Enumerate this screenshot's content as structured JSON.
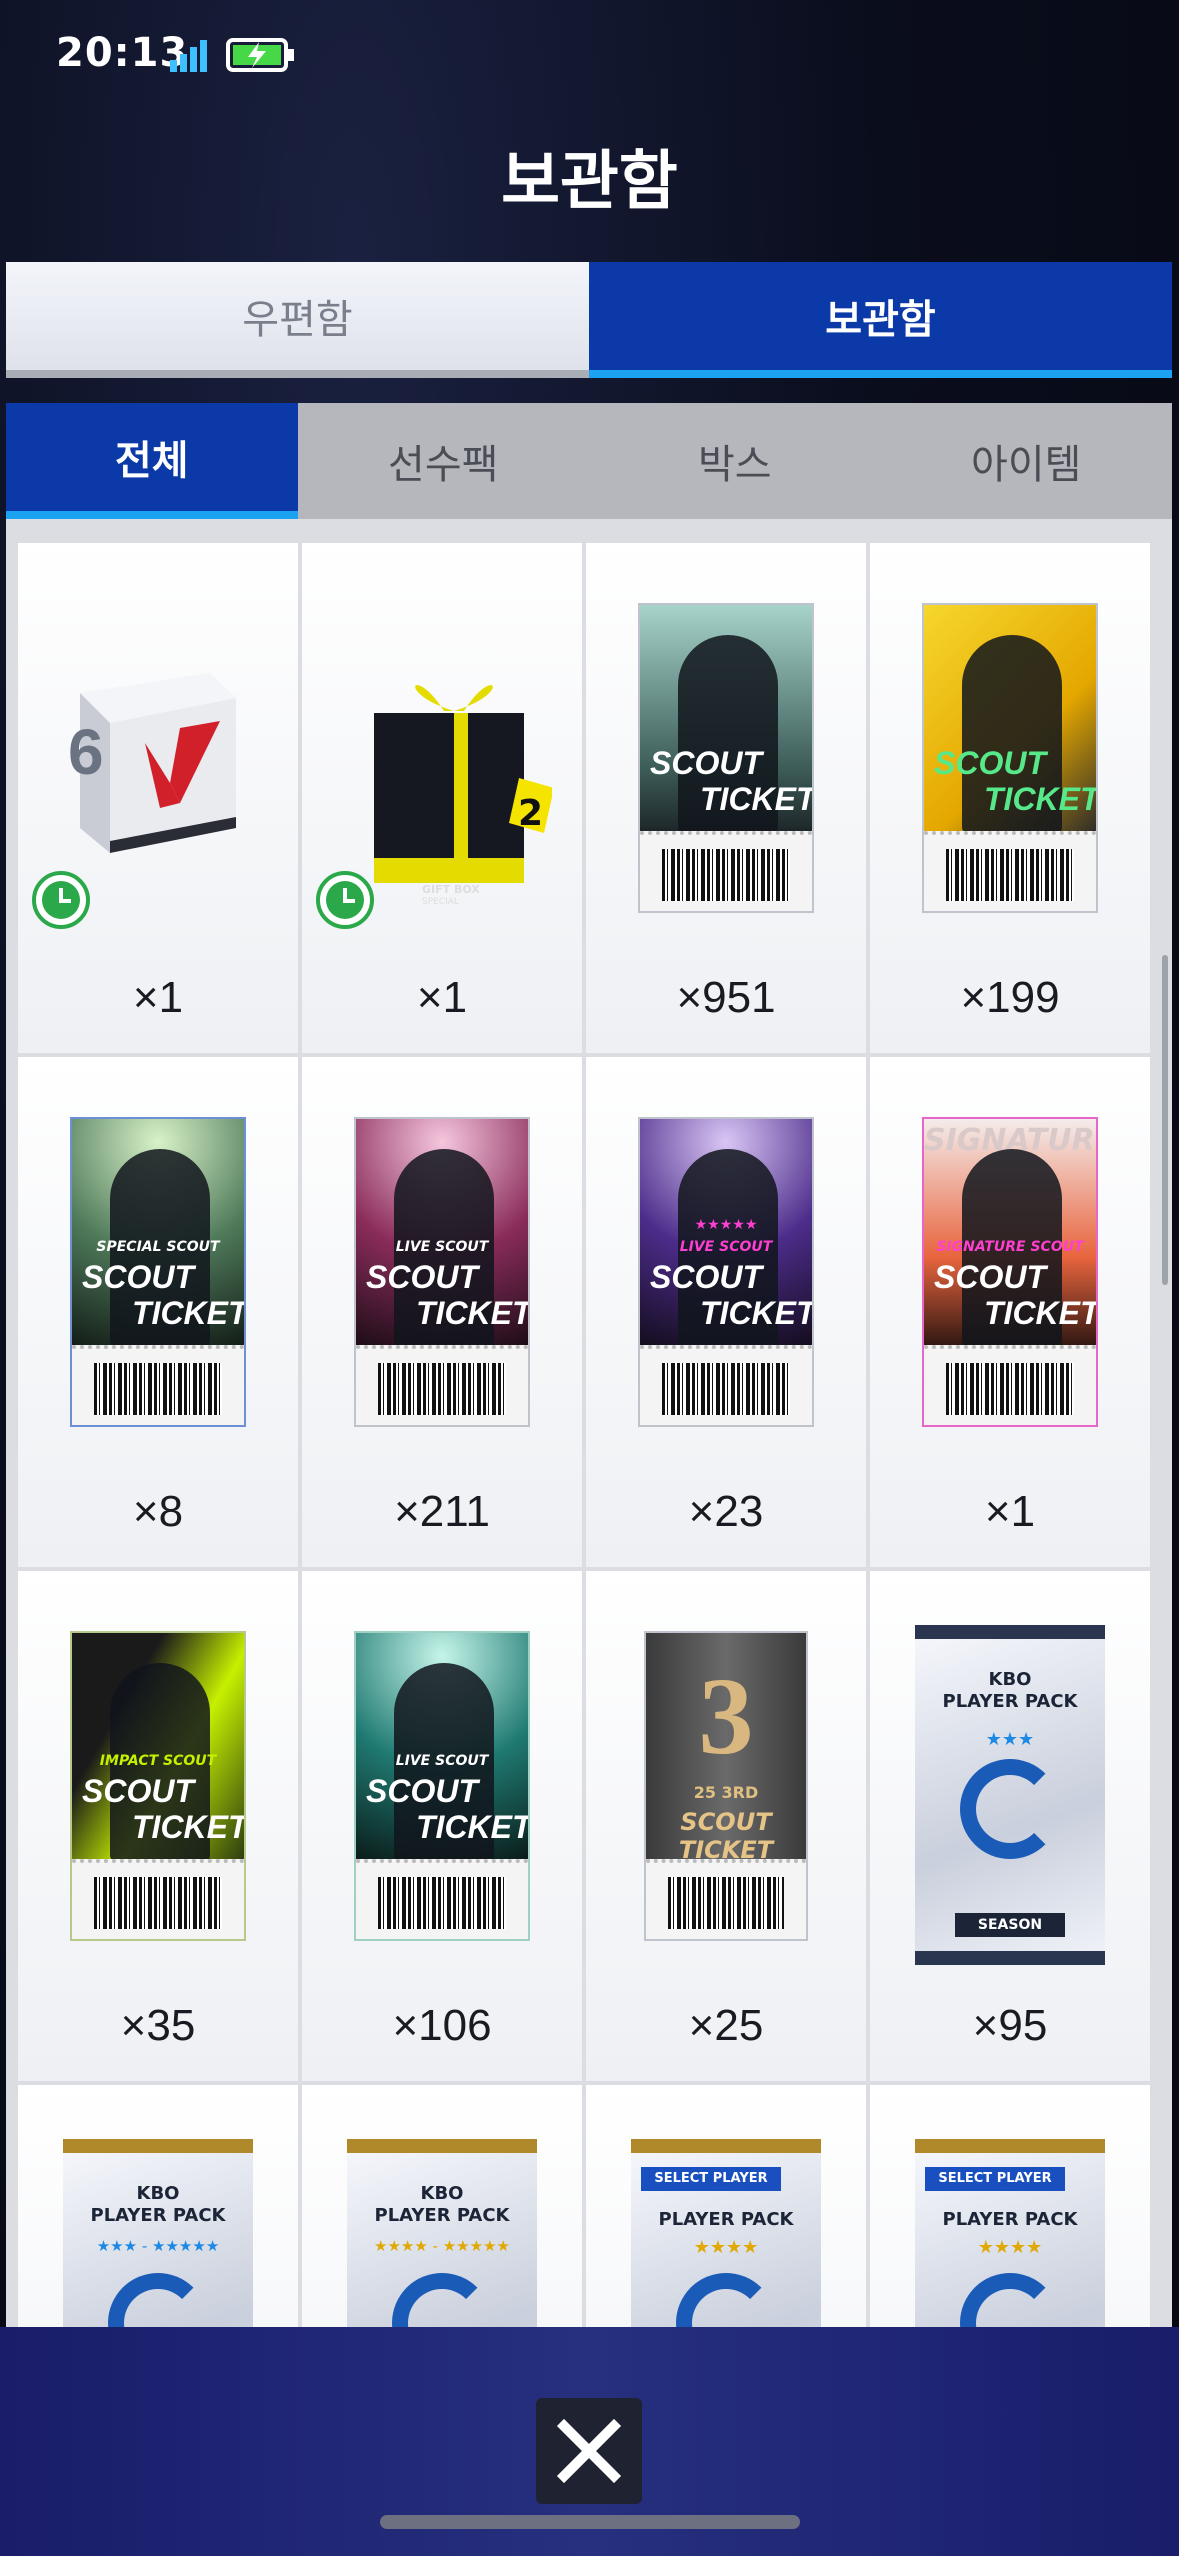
{
  "status": {
    "time": "20:13"
  },
  "header": {
    "title": "보관함"
  },
  "main_tabs": [
    {
      "label": "우편함",
      "active": false
    },
    {
      "label": "보관함",
      "active": true
    }
  ],
  "sub_tabs": [
    {
      "label": "전체",
      "active": true
    },
    {
      "label": "선수팩",
      "active": false
    },
    {
      "label": "박스",
      "active": false
    },
    {
      "label": "아이템",
      "active": false
    }
  ],
  "items": [
    {
      "name": "box-6",
      "count": "×1",
      "box_number": "6"
    },
    {
      "name": "gift-box",
      "count": "×1",
      "line1": "GIFT BOX",
      "line2": "SPECIAL",
      "tag_number": "2"
    },
    {
      "name": "scout-ticket",
      "count": "×951",
      "line1": "SCOUT",
      "line2": "TICKET"
    },
    {
      "name": "gold-scout-ticket",
      "count": "×199",
      "line1": "SCOUT",
      "line2": "TICKET"
    },
    {
      "name": "special-scout-ticket",
      "count": "×8",
      "sub": "SPECIAL SCOUT",
      "line1": "SCOUT",
      "line2": "TICKET"
    },
    {
      "name": "live-scout-ticket",
      "count": "×211",
      "sub": "LIVE SCOUT",
      "line1": "SCOUT",
      "line2": "TICKET"
    },
    {
      "name": "live-scout-ticket-5star",
      "count": "×23",
      "sub": "LIVE SCOUT",
      "stars": "★★★★★",
      "line1": "SCOUT",
      "line2": "TICKET"
    },
    {
      "name": "signature-scout-ticket",
      "count": "×1",
      "sub": "SIGNATURE SCOUT",
      "line1": "SCOUT",
      "line2": "TICKET",
      "bg_text": "SIGNATURE"
    },
    {
      "name": "impact-scout-ticket",
      "count": "×35",
      "sub": "IMPACT SCOUT",
      "line1": "SCOUT",
      "line2": "TICKET"
    },
    {
      "name": "live-scout-ticket-teal",
      "count": "×106",
      "sub": "LIVE SCOUT",
      "line1": "SCOUT",
      "line2": "TICKET"
    },
    {
      "name": "v25-3rd-scout-ticket",
      "count": "×25",
      "number": "3",
      "sub": "25 3RD",
      "line1": "SCOUT TICKET"
    },
    {
      "name": "kbo-player-pack-season",
      "count": "×95",
      "title": "KBO\nPLAYER PACK",
      "stars": "★★★",
      "footer": "SEASON"
    },
    {
      "name": "kbo-player-pack-a",
      "count": "",
      "title": "KBO\nPLAYER PACK",
      "stars": "★★★ - ★★★★★"
    },
    {
      "name": "kbo-player-pack-b",
      "count": "",
      "title": "KBO\nPLAYER PACK",
      "stars": "★★★★ - ★★★★★"
    },
    {
      "name": "select-player-pack-a",
      "count": "",
      "banner": "SELECT PLAYER",
      "title": "PLAYER PACK",
      "stars": "★★★★"
    },
    {
      "name": "select-player-pack-b",
      "count": "",
      "banner": "SELECT PLAYER",
      "title": "PLAYER PACK",
      "stars": "★★★★"
    }
  ],
  "colors": {
    "accent": "#0b3aa8",
    "tab_underline": "#1ba2f0",
    "bottom_bar": "#26307e"
  }
}
